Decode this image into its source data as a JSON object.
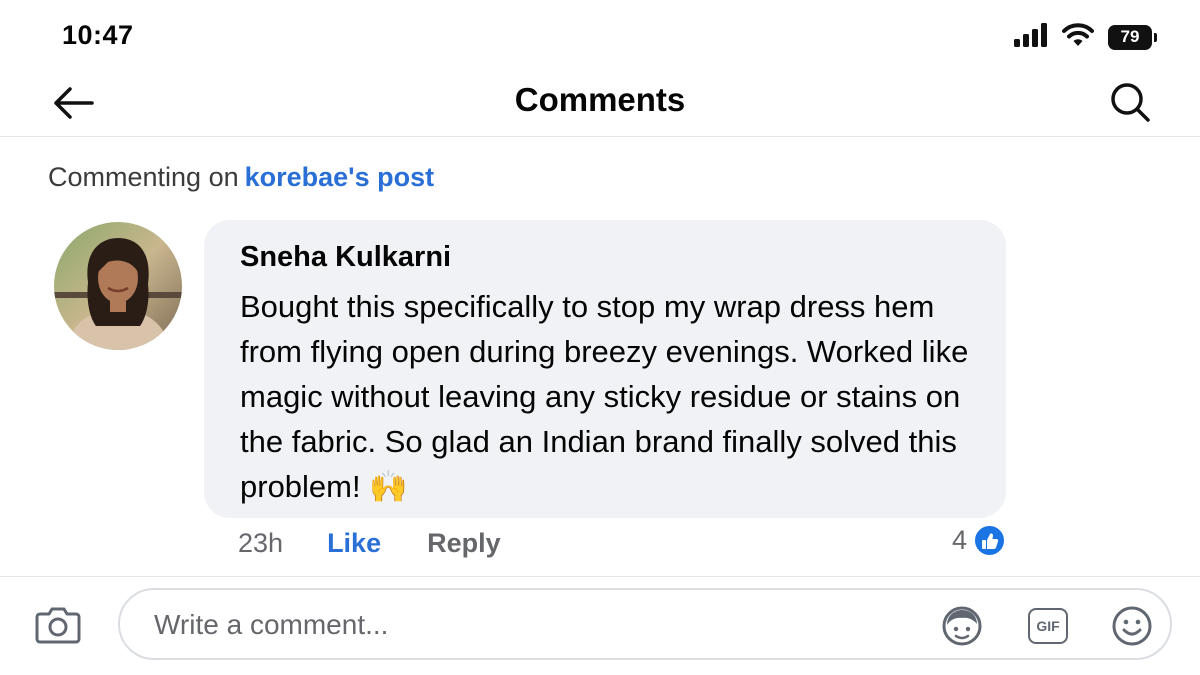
{
  "status_bar": {
    "time": "10:47",
    "battery": "79",
    "icons": [
      "signal-icon",
      "wifi-icon",
      "battery-icon"
    ]
  },
  "header": {
    "title": "Comments",
    "back_icon": "arrow-left-icon",
    "search_icon": "search-icon"
  },
  "context": {
    "prefix": "Commenting on",
    "post_link": "korebae's post"
  },
  "comment": {
    "author": "Sneha Kulkarni",
    "text": "Bought this specifically to stop my wrap dress hem from flying open during breezy evenings. Worked like magic without leaving any sticky residue or stains on the fabric. So glad an Indian brand finally solved this problem! 🙌",
    "time": "23h",
    "like_label": "Like",
    "reply_label": "Reply",
    "reaction_count": "4",
    "reaction_icon": "thumbs-up-icon"
  },
  "composer": {
    "placeholder": "Write a comment...",
    "camera_icon": "camera-icon",
    "avatar_icon": "avatar-sticker-icon",
    "gif_label": "GIF",
    "emoji_icon": "smiley-icon"
  },
  "colors": {
    "link_blue": "#2a6fd6",
    "like_badge": "#1b74e4",
    "bubble_bg": "#f0f2f5"
  }
}
